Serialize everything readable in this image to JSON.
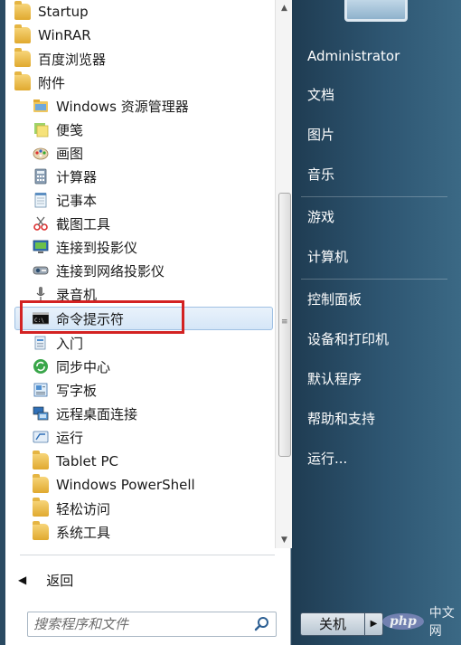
{
  "programs": [
    {
      "label": "Startup",
      "icon": "folder-icon"
    },
    {
      "label": "WinRAR",
      "icon": "folder-icon"
    },
    {
      "label": "百度浏览器",
      "icon": "folder-icon"
    },
    {
      "label": "附件",
      "icon": "folder-icon"
    },
    {
      "label": "Windows 资源管理器",
      "icon": "explorer-icon"
    },
    {
      "label": "便笺",
      "icon": "sticky-notes-icon"
    },
    {
      "label": "画图",
      "icon": "paint-icon"
    },
    {
      "label": "计算器",
      "icon": "calculator-icon"
    },
    {
      "label": "记事本",
      "icon": "notepad-icon"
    },
    {
      "label": "截图工具",
      "icon": "snipping-tool-icon"
    },
    {
      "label": "连接到投影仪",
      "icon": "projector-icon"
    },
    {
      "label": "连接到网络投影仪",
      "icon": "network-projector-icon"
    },
    {
      "label": "录音机",
      "icon": "microphone-icon"
    },
    {
      "label": "命令提示符",
      "icon": "cmd-icon"
    },
    {
      "label": "入门",
      "icon": "getting-started-icon"
    },
    {
      "label": "同步中心",
      "icon": "sync-center-icon"
    },
    {
      "label": "写字板",
      "icon": "wordpad-icon"
    },
    {
      "label": "远程桌面连接",
      "icon": "remote-desktop-icon"
    },
    {
      "label": "运行",
      "icon": "run-icon"
    },
    {
      "label": "Tablet PC",
      "icon": "folder-icon"
    },
    {
      "label": "Windows PowerShell",
      "icon": "folder-icon"
    },
    {
      "label": "轻松访问",
      "icon": "folder-icon"
    },
    {
      "label": "系统工具",
      "icon": "folder-icon"
    }
  ],
  "highlighted_program": "命令提示符",
  "back": {
    "label": "返回"
  },
  "search": {
    "placeholder": "搜索程序和文件"
  },
  "right_menu": {
    "user": "Administrator",
    "documents": "文档",
    "pictures": "图片",
    "music": "音乐",
    "games": "游戏",
    "computer": "计算机",
    "control_panel": "控制面板",
    "devices_printers": "设备和打印机",
    "default_programs": "默认程序",
    "help_support": "帮助和支持",
    "run": "运行..."
  },
  "shutdown": {
    "label": "关机",
    "arrow": "▶"
  },
  "watermark": {
    "logo": "php",
    "text": "中文网"
  },
  "colors": {
    "annotation": "#d32222",
    "right_panel": "#2e5672",
    "highlight": "#d5e6f7"
  }
}
